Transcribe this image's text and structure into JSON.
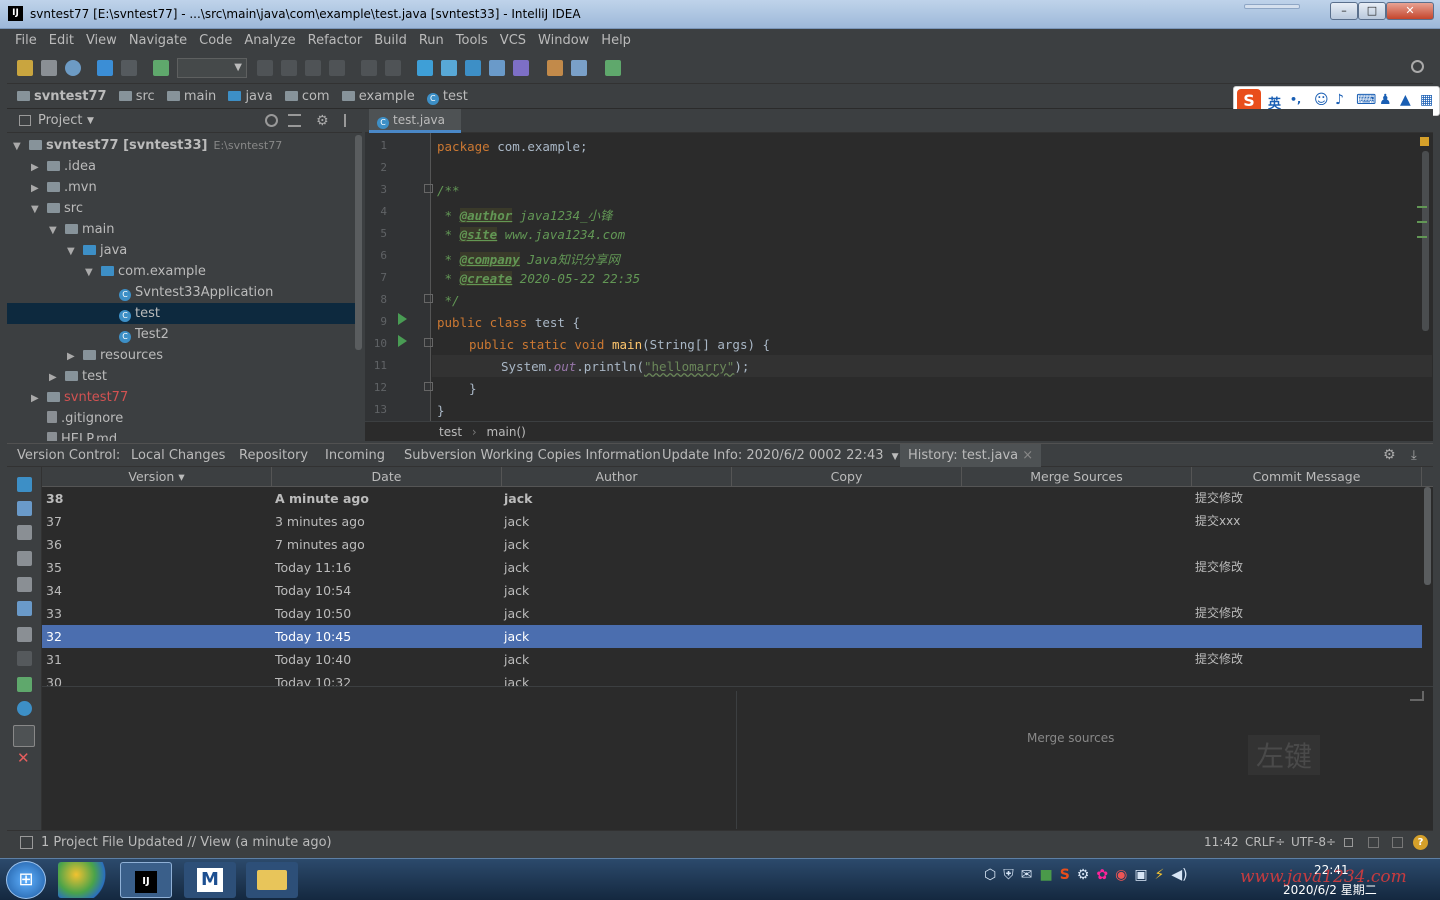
{
  "window": {
    "title": "svntest77 [E:\\svntest77] - ...\\src\\main\\java\\com\\example\\test.java [svntest33] - IntelliJ IDEA",
    "app_icon": "IJ",
    "min": "–",
    "max": "□",
    "close": "✕"
  },
  "menu": [
    "File",
    "Edit",
    "View",
    "Navigate",
    "Code",
    "Analyze",
    "Refactor",
    "Build",
    "Run",
    "Tools",
    "VCS",
    "Window",
    "Help"
  ],
  "breadcrumbs": [
    "svntest77",
    "src",
    "main",
    "java",
    "com",
    "example",
    "test"
  ],
  "ime": {
    "logo": "S",
    "lang": "英",
    "punct": "•,",
    "icons": [
      "☺",
      "♪",
      "⌨",
      "♟",
      "▲",
      "▦"
    ]
  },
  "project": {
    "header": "Project",
    "tree": [
      {
        "label": "svntest77 [svntest33]",
        "extra": "E:\\svntest77",
        "depth": 0,
        "arrow": "▼",
        "icon": "folder"
      },
      {
        "label": ".idea",
        "depth": 1,
        "arrow": "▶",
        "icon": "folder"
      },
      {
        "label": ".mvn",
        "depth": 1,
        "arrow": "▶",
        "icon": "folder"
      },
      {
        "label": "src",
        "depth": 1,
        "arrow": "▼",
        "icon": "folder"
      },
      {
        "label": "main",
        "depth": 2,
        "arrow": "▼",
        "icon": "folder"
      },
      {
        "label": "java",
        "depth": 3,
        "arrow": "▼",
        "icon": "folder"
      },
      {
        "label": "com.example",
        "depth": 4,
        "arrow": "▼",
        "icon": "folder"
      },
      {
        "label": "Svntest33Application",
        "depth": 5,
        "arrow": "",
        "icon": "class"
      },
      {
        "label": "test",
        "depth": 5,
        "arrow": "",
        "icon": "class",
        "selected": true
      },
      {
        "label": "Test2",
        "depth": 5,
        "arrow": "",
        "icon": "class"
      },
      {
        "label": "resources",
        "depth": 3,
        "arrow": "▶",
        "icon": "folder"
      },
      {
        "label": "test",
        "depth": 2,
        "arrow": "▶",
        "icon": "folder"
      },
      {
        "label": "svntest77",
        "depth": 1,
        "arrow": "▶",
        "icon": "folder",
        "red": true
      },
      {
        "label": ".gitignore",
        "depth": 1,
        "arrow": "",
        "icon": "file"
      },
      {
        "label": "HELP.md",
        "depth": 1,
        "arrow": "",
        "icon": "file"
      }
    ]
  },
  "editor": {
    "tab": "test.java",
    "tab_close": "×",
    "line_numbers": [
      "1",
      "2",
      "3",
      "4",
      "5",
      "6",
      "7",
      "8",
      "9",
      "10",
      "11",
      "12",
      "13"
    ],
    "lines": {
      "l1_kw": "package",
      "l1_rest": " com.example;",
      "l3": "/**",
      "l4_pre": " * ",
      "l4_tag": "@author",
      "l4_val": " java1234_小锋",
      "l5_pre": " * ",
      "l5_tag": "@site",
      "l5_val": " www.java1234.com",
      "l6_pre": " * ",
      "l6_tag": "@company",
      "l6_val": " Java知识分享网",
      "l7_pre": " * ",
      "l7_tag": "@create",
      "l7_val": " 2020-05-22 22:35",
      "l8": " */",
      "l9_kw": "public class",
      "l9_rest": " test {",
      "l10_kw": "public static void",
      "l10_fn": " main",
      "l10_rest": "(String[] args) {",
      "l11_a": "System.",
      "l11_out": "out",
      "l11_b": ".println(",
      "l11_str": "\"hellomarry\"",
      "l11_c": ");",
      "l12": "}",
      "l13": "}"
    },
    "crumb": [
      "test",
      "main()"
    ],
    "crumb_sep": "›"
  },
  "vc": {
    "label": "Version Control:",
    "tabs": [
      "Local Changes",
      "Repository",
      "Incoming",
      "Subversion Working Copies Information",
      "Update Info: 2020/6/2 0002 22:43",
      "History: test.java"
    ],
    "dropdown": "▼",
    "tab_close": "×",
    "gear": "⚙",
    "pin": "⤓",
    "columns": [
      "Version ▾",
      "Date",
      "Author",
      "Copy",
      "Merge Sources",
      "Commit Message"
    ],
    "rows": [
      {
        "version": "38",
        "date": "A minute ago",
        "author": "jack",
        "copy": "",
        "merge": "",
        "msg": "提交修改",
        "bold": true
      },
      {
        "version": "37",
        "date": "3 minutes ago",
        "author": "jack",
        "copy": "",
        "merge": "",
        "msg": "提交xxx"
      },
      {
        "version": "36",
        "date": "7 minutes ago",
        "author": "jack",
        "copy": "",
        "merge": "",
        "msg": ""
      },
      {
        "version": "35",
        "date": "Today 11:16",
        "author": "jack",
        "copy": "",
        "merge": "",
        "msg": "提交修改"
      },
      {
        "version": "34",
        "date": "Today 10:54",
        "author": "jack",
        "copy": "",
        "merge": "",
        "msg": ""
      },
      {
        "version": "33",
        "date": "Today 10:50",
        "author": "jack",
        "copy": "",
        "merge": "",
        "msg": "提交修改"
      },
      {
        "version": "32",
        "date": "Today 10:45",
        "author": "jack",
        "copy": "",
        "merge": "",
        "msg": "",
        "selected": true
      },
      {
        "version": "31",
        "date": "Today 10:40",
        "author": "jack",
        "copy": "",
        "merge": "",
        "msg": "提交修改"
      },
      {
        "version": "30",
        "date": "Today 10:32",
        "author": "jack",
        "copy": "",
        "merge": "",
        "msg": ""
      }
    ],
    "merge_sources_label": "Merge sources",
    "watermark": "左键"
  },
  "status": {
    "message": "1 Project File Updated // View (a minute ago)",
    "position": "11:42",
    "line_sep": "CRLF÷",
    "encoding": "UTF-8÷",
    "help": "?"
  },
  "taskbar": {
    "time": "22:41",
    "date": "2020/6/2 星期二",
    "watermark": "www.java1234.com",
    "start": "⊞",
    "tray": [
      "⬡",
      "⛨",
      "✉",
      "■",
      "S",
      "⚙",
      "✿",
      "◉",
      "▣",
      "⚡",
      "◀)"
    ]
  },
  "colors": {
    "selection": "#4b6eaf",
    "tree_selection": "#0d293e",
    "keyword": "#cc7832",
    "comment": "#629755",
    "string": "#6a8759",
    "accent": "#3d8fc6"
  }
}
